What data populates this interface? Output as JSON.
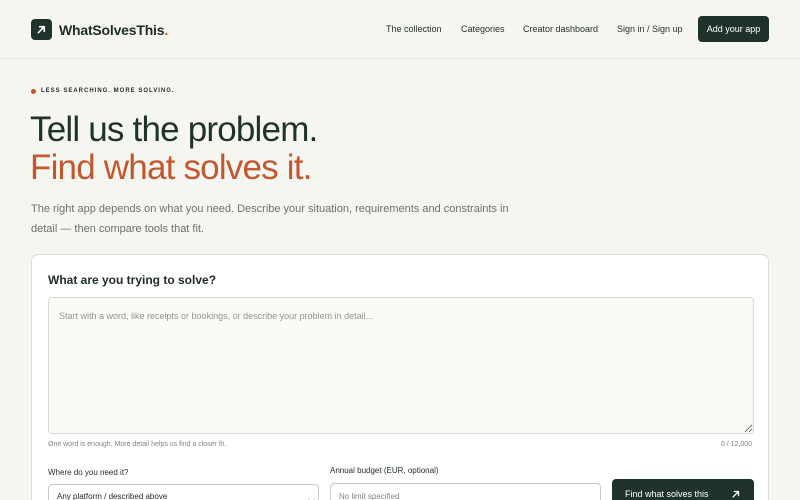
{
  "header": {
    "brand": "WhatSolvesThis",
    "brand_dot": ".",
    "nav": [
      "The collection",
      "Categories",
      "Creator dashboard",
      "Sign in / Sign up"
    ],
    "cta_label": "Add your app"
  },
  "hero": {
    "eyebrow": "LESS SEARCHING. MORE SOLVING.",
    "headline_1": "Tell us the problem.",
    "headline_2": "Find what solves it.",
    "lead": "The right app depends on what you need. Describe your situation, requirements and constraints in detail — then compare tools that fit."
  },
  "form": {
    "title": "What are you trying to solve?",
    "problem_placeholder": "Start with a word, like receipts or bookings, or describe your problem in detail...",
    "hint": "One word is enough. More detail helps us find a closer fit.",
    "counter": "0 / 12,000",
    "platform_label": "Where do you need it?",
    "platform_selected": "Any platform / described above",
    "budget_label": "Annual budget (EUR, optional)",
    "budget_placeholder": "No limit specified",
    "submit_label": "Find what solves this"
  },
  "colors": {
    "accent": "#c3572f",
    "primary": "#1f332b",
    "background": "#f6f6f1"
  },
  "icons": {
    "logo": "arrow-up-right-icon",
    "submit": "arrow-up-right-icon",
    "select": "chevron-down-icon"
  }
}
